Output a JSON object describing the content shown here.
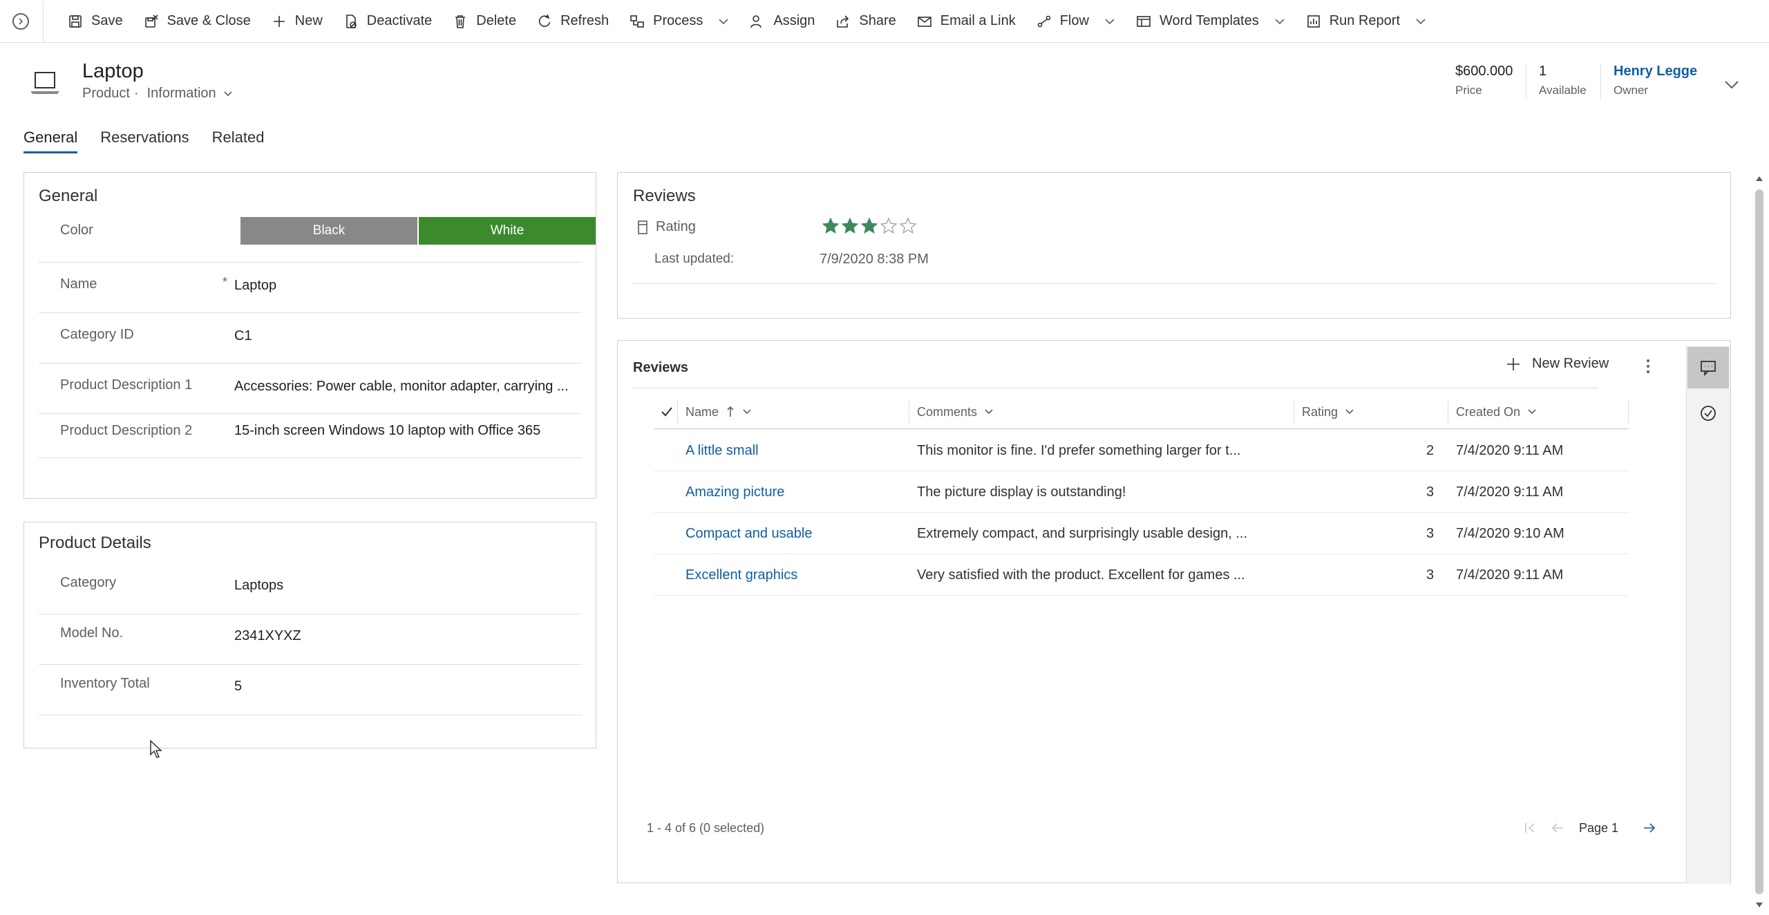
{
  "toolbar": {
    "items": [
      {
        "label": "Save",
        "icon": "save-icon"
      },
      {
        "label": "Save & Close",
        "icon": "save-close-icon"
      },
      {
        "label": "New",
        "icon": "plus-icon"
      },
      {
        "label": "Deactivate",
        "icon": "deactivate-icon"
      },
      {
        "label": "Delete",
        "icon": "trash-icon"
      },
      {
        "label": "Refresh",
        "icon": "refresh-icon"
      },
      {
        "label": "Process",
        "icon": "process-icon"
      },
      {
        "label": "Assign",
        "icon": "assign-icon"
      },
      {
        "label": "Share",
        "icon": "share-icon"
      },
      {
        "label": "Email a Link",
        "icon": "email-icon"
      },
      {
        "label": "Flow",
        "icon": "flow-icon"
      },
      {
        "label": "Word Templates",
        "icon": "word-icon"
      },
      {
        "label": "Run Report",
        "icon": "report-icon"
      }
    ]
  },
  "header": {
    "title": "Laptop",
    "entity": "Product",
    "dot": "·",
    "form": "Information",
    "price": {
      "value": "$600.000",
      "label": "Price"
    },
    "available": {
      "value": "1",
      "label": "Available"
    },
    "owner": {
      "value": "Henry Legge",
      "label": "Owner"
    }
  },
  "tabs": [
    "General",
    "Reservations",
    "Related"
  ],
  "general": {
    "title": "General",
    "color_label": "Color",
    "color_options": [
      "Black",
      "White"
    ],
    "color_selected": "White",
    "colors": {
      "black_btn": "#8a8886",
      "white_btn": "#3c8a2e"
    },
    "fields": [
      {
        "label": "Name",
        "value": "Laptop",
        "required": "*"
      },
      {
        "label": "Category ID",
        "value": "C1"
      },
      {
        "label": "Product Description 1",
        "value": "Accessories: Power cable, monitor adapter, carrying ..."
      },
      {
        "label": "Product Description 2",
        "value": "15-inch screen Windows 10 laptop with Office 365"
      }
    ]
  },
  "details": {
    "title": "Product Details",
    "fields": [
      {
        "label": "Category",
        "value": "Laptops"
      },
      {
        "label": "Model No.",
        "value": "2341XYXZ"
      },
      {
        "label": "Inventory Total",
        "value": "5"
      }
    ]
  },
  "reviews_summary": {
    "title": "Reviews",
    "rating_label": "Rating",
    "rating": 3,
    "rating_max": 5,
    "last_updated_label": "Last updated:",
    "last_updated": "7/9/2020 8:38 PM"
  },
  "reviews_grid": {
    "title": "Reviews",
    "new_label": "New Review",
    "columns": [
      "Name",
      "Comments",
      "Rating",
      "Created On"
    ],
    "rows": [
      {
        "name": "A little small",
        "comments": "This monitor is fine. I'd prefer something larger for t...",
        "rating": "2",
        "created": "7/4/2020 9:11 AM"
      },
      {
        "name": "Amazing picture",
        "comments": "The picture display is outstanding!",
        "rating": "3",
        "created": "7/4/2020 9:11 AM"
      },
      {
        "name": "Compact and usable",
        "comments": "Extremely compact, and surprisingly usable design, ...",
        "rating": "3",
        "created": "7/4/2020 9:10 AM"
      },
      {
        "name": "Excellent graphics",
        "comments": "Very satisfied with the product. Excellent for games ...",
        "rating": "3",
        "created": "7/4/2020 9:11 AM"
      }
    ],
    "footer": "1 - 4 of 6 (0 selected)",
    "page": "Page 1"
  },
  "colors": {
    "accent": "#115ea3",
    "star": "#3c8a5c"
  }
}
